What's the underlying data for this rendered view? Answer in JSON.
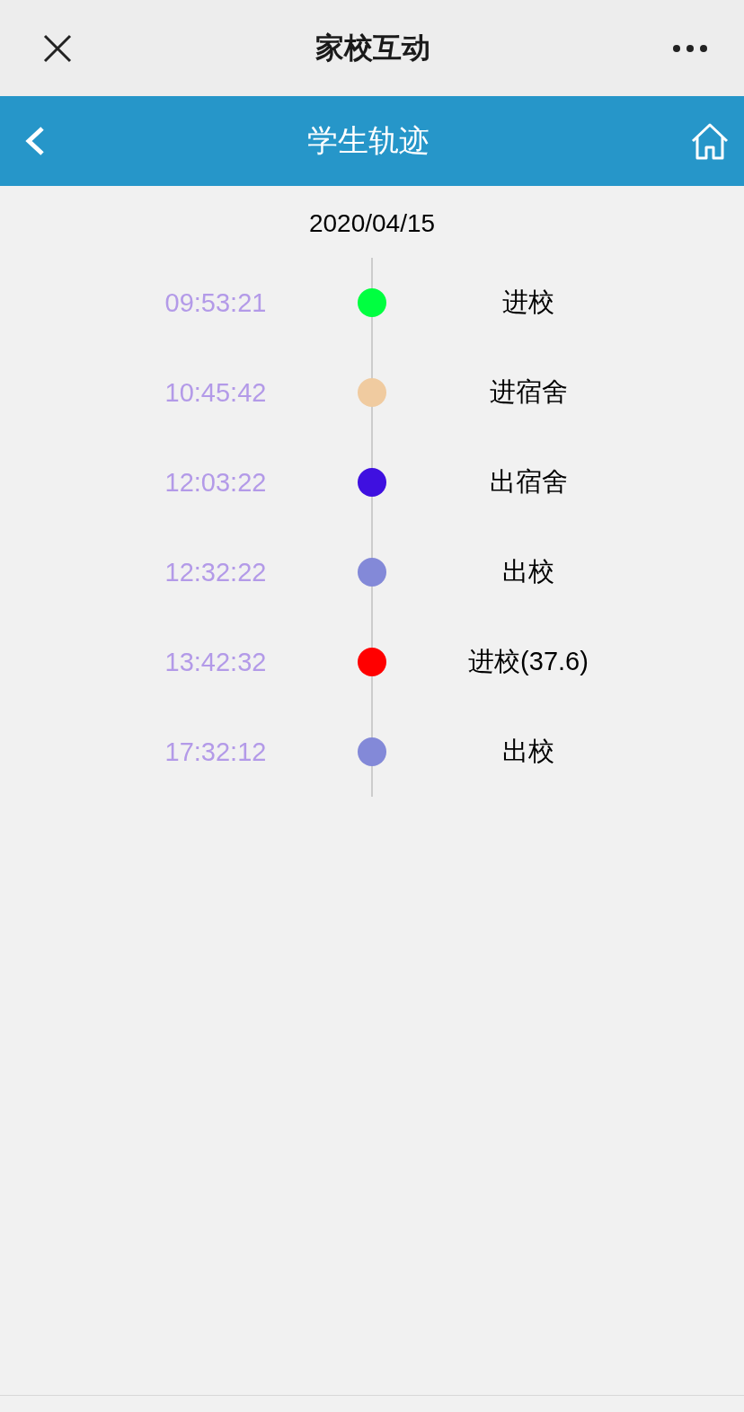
{
  "top_bar": {
    "title": "家校互动"
  },
  "header": {
    "title": "学生轨迹"
  },
  "date": "2020/04/15",
  "events": [
    {
      "time": "09:53:21",
      "label": "进校",
      "color": "#00ff40"
    },
    {
      "time": "10:45:42",
      "label": "进宿舍",
      "color": "#f0cba0"
    },
    {
      "time": "12:03:22",
      "label": "出宿舍",
      "color": "#3f10e0"
    },
    {
      "time": "12:32:22",
      "label": "出校",
      "color": "#8389d8"
    },
    {
      "time": "13:42:32",
      "label": "进校(37.6)",
      "color": "#ff0000"
    },
    {
      "time": "17:32:12",
      "label": "出校",
      "color": "#8389d8"
    }
  ]
}
